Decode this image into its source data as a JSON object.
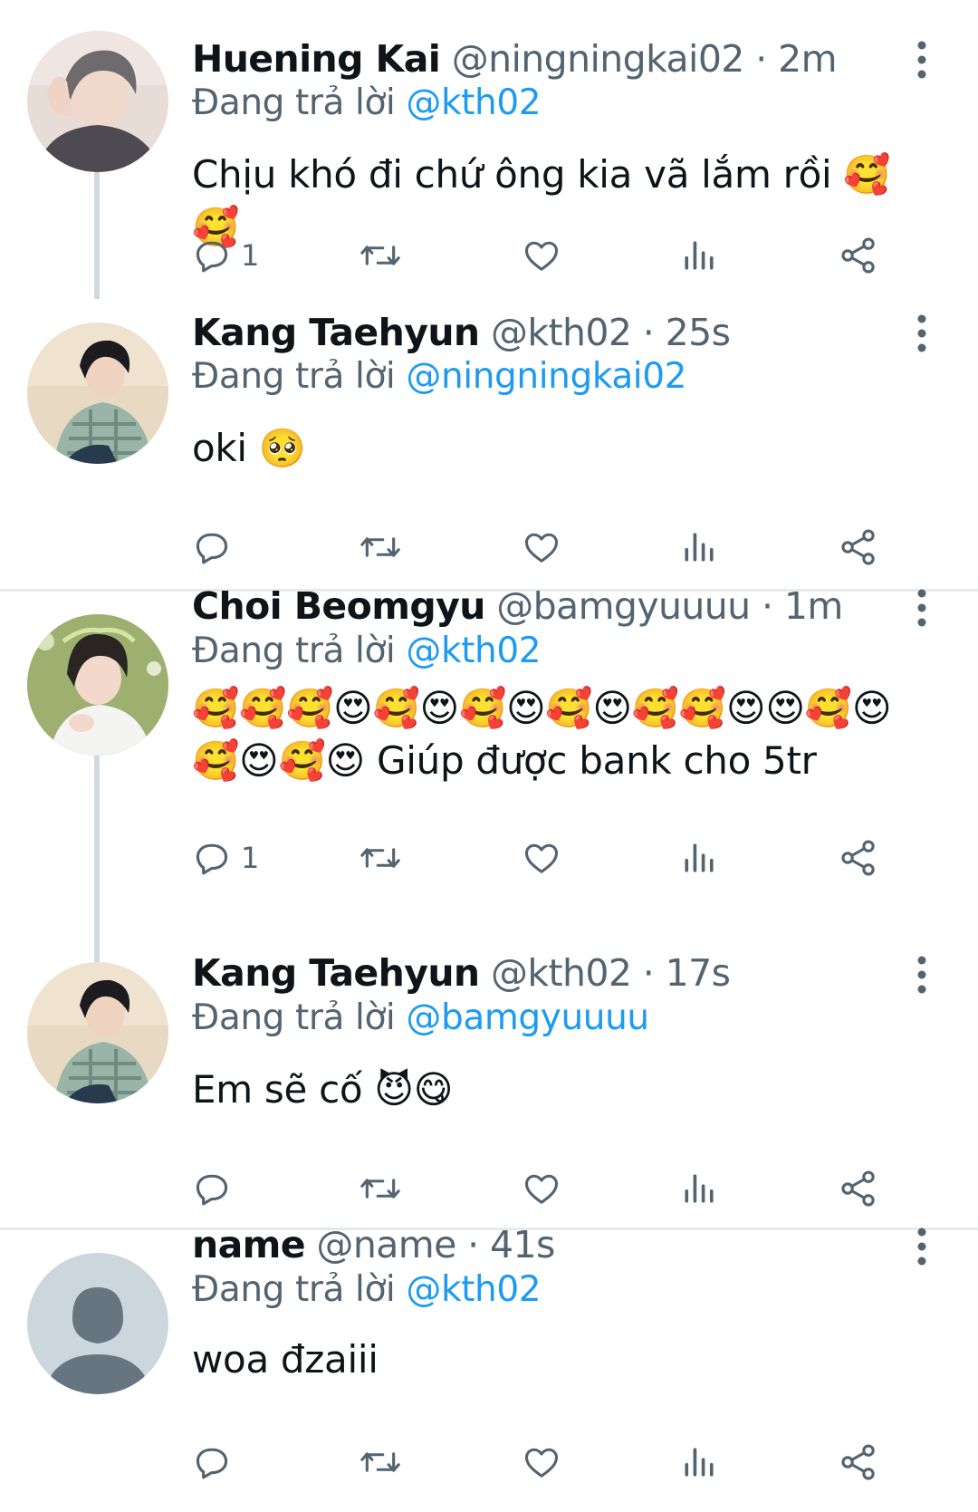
{
  "tweets": [
    {
      "display_name": "Huening Kai",
      "handle": "@ningningkai02",
      "separator": "·",
      "time": "2m",
      "reply_prefix": "Đang trả lời",
      "reply_to": "@kth02",
      "text": "Chịu khó đi chứ ông kia vã lắm rồi 🥰🥰",
      "reply_count": "1",
      "avatar": "photo-huening-kai"
    },
    {
      "display_name": "Kang Taehyun",
      "handle": "@kth02",
      "separator": "·",
      "time": "25s",
      "reply_prefix": "Đang trả lời",
      "reply_to": "@ningningkai02",
      "text": "oki 🥺",
      "reply_count": "",
      "avatar": "photo-kang-taehyun"
    },
    {
      "display_name": "Choi Beomgyu",
      "handle": "@bamgyuuuu",
      "separator": "·",
      "time": "1m",
      "reply_prefix": "Đang trả lời",
      "reply_to": "@kth02",
      "text": "🥰🥰🥰😍🥰😍🥰😍🥰😍🥰🥰😍😍🥰😍🥰😍🥰😍 Giúp được bank cho 5tr",
      "reply_count": "1",
      "avatar": "photo-choi-beomgyu"
    },
    {
      "display_name": "Kang Taehyun",
      "handle": "@kth02",
      "separator": "·",
      "time": "17s",
      "reply_prefix": "Đang trả lời",
      "reply_to": "@bamgyuuuu",
      "text": "Em sẽ cố 😈😋",
      "reply_count": "",
      "avatar": "photo-kang-taehyun"
    },
    {
      "display_name": "name",
      "handle": "@name",
      "separator": "·",
      "time": "41s",
      "reply_prefix": "Đang trả lời",
      "reply_to": "@kth02",
      "text": "woa đzaiii",
      "reply_count": "",
      "avatar": "default-avatar-icon"
    }
  ],
  "icons": {
    "reply": "reply-icon",
    "retweet": "retweet-icon",
    "like": "like-icon",
    "views": "views-icon",
    "share": "share-icon",
    "more": "more-vertical-icon"
  },
  "colors": {
    "link": "#1d9bf0",
    "secondary_text": "#536471",
    "primary_text": "#0f1419",
    "thread_line": "#cfd9de",
    "divider": "#e7eaec",
    "icon": "#536471"
  }
}
